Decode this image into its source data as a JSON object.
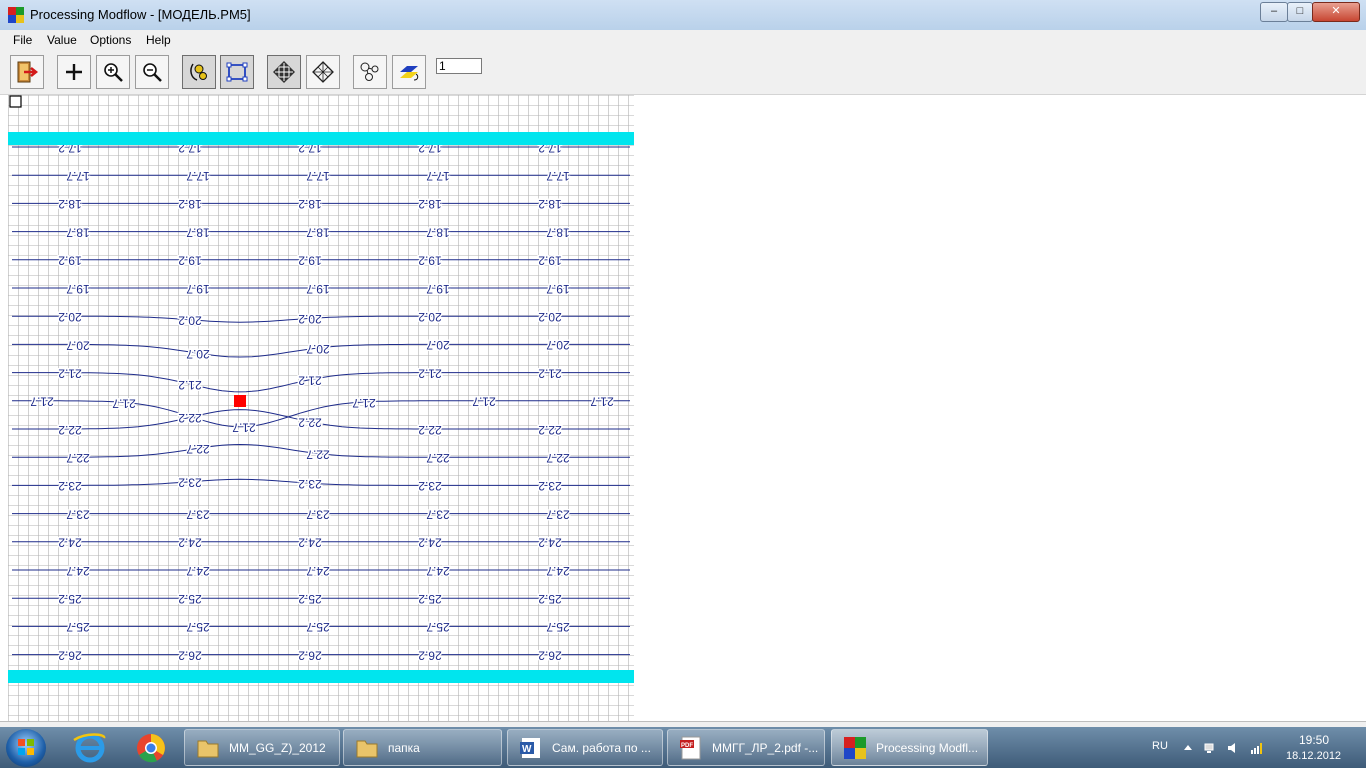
{
  "window": {
    "title": "Processing Modflow - [МОДЕЛЬ.PM5]",
    "controls": {
      "minimize": "–",
      "maximize": "□",
      "close": "✕"
    }
  },
  "menu": {
    "items": [
      "File",
      "Value",
      "Options",
      "Help"
    ]
  },
  "toolbar": {
    "buttons": [
      "exit",
      "add",
      "zoom-in",
      "zoom-out",
      "bounds",
      "polygon",
      "grid",
      "mesh",
      "properties",
      "layer-view"
    ],
    "layer_value": "1"
  },
  "map": {
    "colors": {
      "grid": "#b3b3b3",
      "boundary": "#00e5ee",
      "contour": "#1e2b8a",
      "well": "#ff0000"
    },
    "contour_rows": [
      {
        "value": "17.2",
        "labels": [
          "17.2",
          "17.2",
          "17.2",
          "17.2",
          "17.2"
        ]
      },
      {
        "value": "17.7",
        "labels": [
          "17.7",
          "17.7",
          "17.7",
          "17.7",
          "17.7"
        ]
      },
      {
        "value": "18.2",
        "labels": [
          "18.2",
          "18.2",
          "18.2",
          "18.2",
          "18.2"
        ]
      },
      {
        "value": "18.7",
        "labels": [
          "18.7",
          "18.7",
          "18.7",
          "18.7",
          "18.7"
        ]
      },
      {
        "value": "19.2",
        "labels": [
          "19.2",
          "19.2",
          "19.2",
          "19.2",
          "19.2"
        ]
      },
      {
        "value": "19.7",
        "labels": [
          "19.7",
          "19.7",
          "19.7",
          "19.7",
          "19.7"
        ]
      },
      {
        "value": "20.2",
        "labels": [
          "20.2",
          "20.2",
          "20.2",
          "20.2",
          "20.2"
        ]
      },
      {
        "value": "20.7",
        "labels": [
          "20.7",
          "20.7",
          "20.7",
          "20.7",
          "20.7"
        ]
      },
      {
        "value": "21.2",
        "labels": [
          "21.2",
          "21.2",
          "21.2",
          "21.2",
          "21.2"
        ]
      },
      {
        "value": "21.7",
        "labels": [
          "21.7",
          "21.7",
          "21.7",
          "21.7",
          "21.7",
          "21.7"
        ]
      },
      {
        "value": "22.2",
        "labels": [
          "22.2",
          "22.2",
          "22.2",
          "22.2",
          "22.2"
        ]
      },
      {
        "value": "22.7",
        "labels": [
          "22.7",
          "22.7",
          "22.7",
          "22.7",
          "22.7"
        ]
      },
      {
        "value": "23.2",
        "labels": [
          "23.2",
          "23.2",
          "23.2",
          "23.2",
          "23.2"
        ]
      },
      {
        "value": "23.7",
        "labels": [
          "23.7",
          "23.7",
          "23.7",
          "23.7",
          "23.7"
        ]
      },
      {
        "value": "24.2",
        "labels": [
          "24.2",
          "24.2",
          "24.2",
          "24.2",
          "24.2"
        ]
      },
      {
        "value": "24.7",
        "labels": [
          "24.7",
          "24.7",
          "24.7",
          "24.7",
          "24.7"
        ]
      },
      {
        "value": "25.2",
        "labels": [
          "25.2",
          "25.2",
          "25.2",
          "25.2",
          "25.2"
        ]
      },
      {
        "value": "25.7",
        "labels": [
          "25.7",
          "25.7",
          "25.7",
          "25.7",
          "25.7"
        ]
      },
      {
        "value": "26.2",
        "labels": [
          "26.2",
          "26.2",
          "26.2",
          "26.2",
          "26.2"
        ]
      }
    ]
  },
  "taskbar": {
    "colors": {
      "base": "#3e5b78"
    },
    "pinned": [
      "internet-explorer-icon",
      "chrome-icon"
    ],
    "tasks": [
      {
        "label": "MM_GG_Z)_2012",
        "icon": "folder-icon"
      },
      {
        "label": "папка",
        "icon": "folder-icon"
      },
      {
        "label": "Сам. работа по ...",
        "icon": "word-icon"
      },
      {
        "label": "ММГГ_ЛР_2.pdf -...",
        "icon": "pdf-icon"
      },
      {
        "label": "Processing Modfl...",
        "icon": "modflow-icon"
      }
    ],
    "tray": {
      "language": "RU",
      "time": "19:50",
      "date": "18.12.2012"
    }
  }
}
